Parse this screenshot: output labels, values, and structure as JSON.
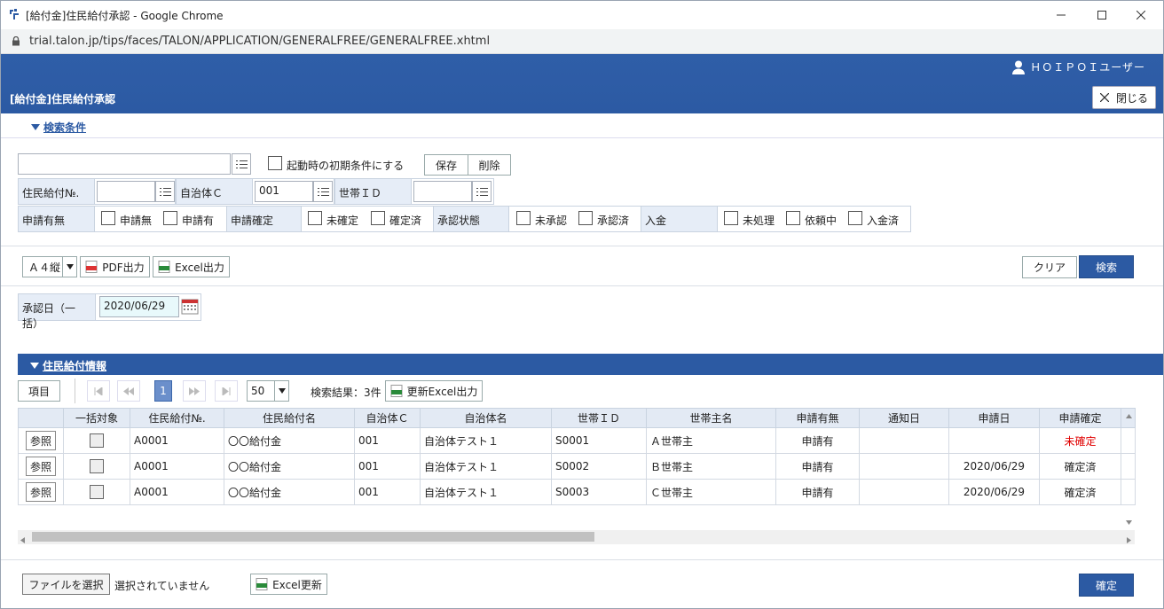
{
  "window": {
    "title": "[給付金]住民給付承認 - Google Chrome",
    "url": "trial.talon.jp/tips/faces/TALON/APPLICATION/GENERALFREE/GENERALFREE.xhtml"
  },
  "header": {
    "user": "ＨＯＩＰＯＩユーザー",
    "page_title": "[給付金]住民給付承認",
    "close_label": "閉じる"
  },
  "search": {
    "section_label": "検索条件",
    "preset_value": "",
    "initial_cond_label": "起動時の初期条件にする",
    "save_label": "保存",
    "delete_label": "削除",
    "fields": {
      "jumin_no_label": "住民給付№.",
      "jumin_no_value": "",
      "jichitai_label": "自治体Ｃ",
      "jichitai_value": "001",
      "setai_label": "世帯ＩＤ",
      "setai_value": ""
    },
    "shinsei_umu": {
      "label": "申請有無",
      "opt1": "申請無",
      "opt2": "申請有"
    },
    "shinsei_kakutei": {
      "label": "申請確定",
      "opt1": "未確定",
      "opt2": "確定済"
    },
    "shonin_jotai": {
      "label": "承認状態",
      "opt1": "未承認",
      "opt2": "承認済"
    },
    "nyukin": {
      "label": "入金",
      "opt1": "未処理",
      "opt2": "依頼中",
      "opt3": "入金済"
    }
  },
  "toolbar": {
    "paper": "Ａ４縦",
    "pdf_label": "PDF出力",
    "excel_label": "Excel出力",
    "clear_label": "クリア",
    "search_label": "検索"
  },
  "approval": {
    "label": "承認日（一括）",
    "value": "2020/06/29"
  },
  "results": {
    "section_label": "住民給付情報",
    "items_label": "項目",
    "page": "1",
    "page_size": "50",
    "count_text": "検索結果：3件",
    "update_excel_label": "更新Excel出力",
    "columns": [
      "",
      "一括対象",
      "住民給付№.",
      "住民給付名",
      "自治体Ｃ",
      "自治体名",
      "世帯ＩＤ",
      "世帯主名",
      "申請有無",
      "通知日",
      "申請日",
      "申請確定"
    ],
    "rows": [
      {
        "ref": "参照",
        "no": "A0001",
        "name": "〇〇給付金",
        "jc": "001",
        "jname": "自治体テスト１",
        "sid": "S0001",
        "head": "Ａ世帯主",
        "umu": "申請有",
        "notice": "",
        "date": "",
        "kakutei": "未確定"
      },
      {
        "ref": "参照",
        "no": "A0001",
        "name": "〇〇給付金",
        "jc": "001",
        "jname": "自治体テスト１",
        "sid": "S0002",
        "head": "Ｂ世帯主",
        "umu": "申請有",
        "notice": "",
        "date": "2020/06/29",
        "kakutei": "確定済"
      },
      {
        "ref": "参照",
        "no": "A0001",
        "name": "〇〇給付金",
        "jc": "001",
        "jname": "自治体テスト１",
        "sid": "S0003",
        "head": "Ｃ世帯主",
        "umu": "申請有",
        "notice": "",
        "date": "2020/06/29",
        "kakutei": "確定済"
      }
    ]
  },
  "footer": {
    "file_label": "ファイルを選択",
    "file_status": "選択されていません",
    "excel_update_label": "Excel更新",
    "confirm_label": "確定"
  },
  "colors": {
    "brand": "#2c5aa3",
    "unconfirmed": "#e00000"
  }
}
